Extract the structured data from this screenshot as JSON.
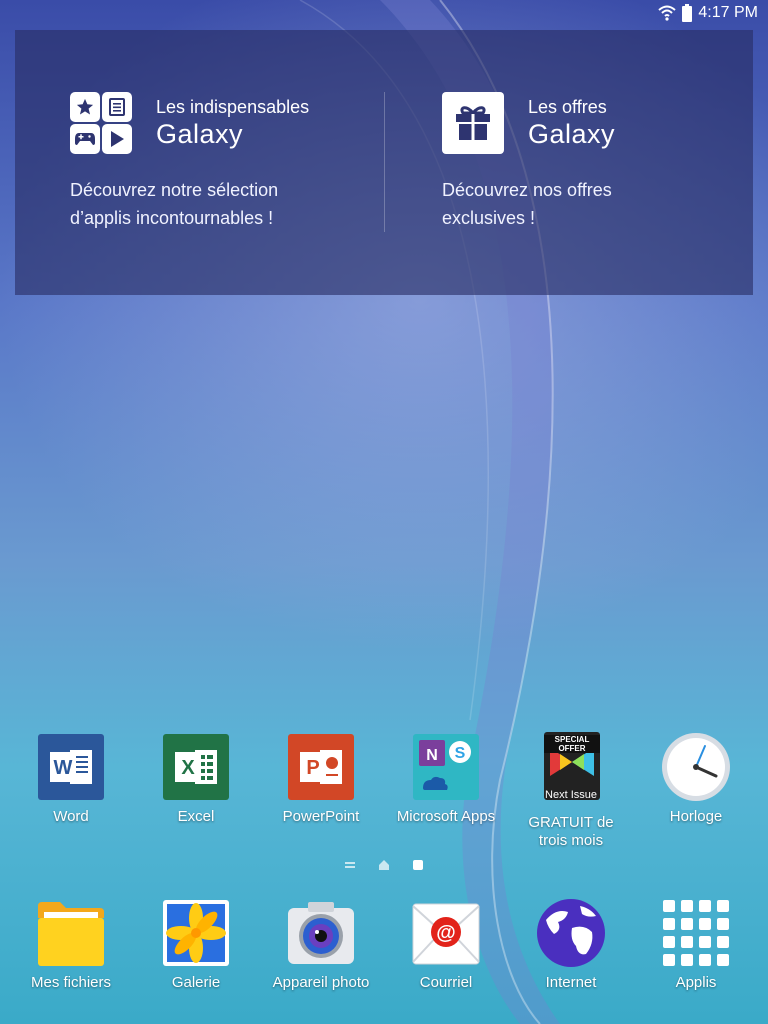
{
  "status_bar": {
    "time": "4:17 PM",
    "wifi_icon": "wifi-icon",
    "battery_icon": "battery-icon"
  },
  "widget": {
    "left": {
      "subtitle": "Les indispensables",
      "title": "Galaxy",
      "description_line1": "Découvrez notre sélection",
      "description_line2": "d’applis incontournables !",
      "icon": "apps-grid-icon"
    },
    "right": {
      "subtitle": "Les offres",
      "title": "Galaxy",
      "description_line1": "Découvrez nos offres",
      "description_line2": "exclusives !",
      "icon": "gift-icon"
    }
  },
  "apps": [
    {
      "label": "Word",
      "icon": "word-icon",
      "color": "#2b579a"
    },
    {
      "label": "Excel",
      "icon": "excel-icon",
      "color": "#217346"
    },
    {
      "label": "PowerPoint",
      "icon": "powerpoint-icon",
      "color": "#d24726"
    },
    {
      "label": "Microsoft Apps",
      "icon": "microsoft-apps-icon",
      "color": "#2fb7c4"
    },
    {
      "label_line1": "GRATUIT de",
      "label_line2": "trois mois",
      "badge_top": "SPECIAL OFFER",
      "badge_bottom": "Next Issue",
      "icon": "next-issue-icon"
    },
    {
      "label": "Horloge",
      "icon": "clock-icon"
    }
  ],
  "dock": [
    {
      "label": "Mes fichiers",
      "icon": "folder-icon"
    },
    {
      "label": "Galerie",
      "icon": "gallery-icon"
    },
    {
      "label": "Appareil photo",
      "icon": "camera-icon"
    },
    {
      "label": "Courriel",
      "icon": "email-icon"
    },
    {
      "label": "Internet",
      "icon": "globe-icon"
    },
    {
      "label": "Applis",
      "icon": "apps-drawer-icon"
    }
  ],
  "pager": {
    "pages": [
      "page-list-indicator",
      "home-page-indicator",
      "page-indicator-current"
    ],
    "current_index": 2
  }
}
